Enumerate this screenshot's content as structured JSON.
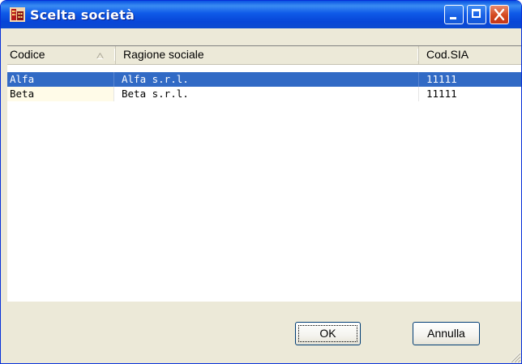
{
  "window": {
    "title": "Scelta società",
    "icon": "company-app-icon",
    "controls": [
      "minimize-icon",
      "maximize-icon",
      "close-icon"
    ]
  },
  "table": {
    "columns": [
      "Codice",
      "Ragione sociale",
      "Cod.SIA"
    ],
    "sort_indicator": "sort-ascending-icon",
    "rows": [
      {
        "code": "Alfa",
        "name": "Alfa s.r.l.",
        "sia": "11111",
        "selected": true
      },
      {
        "code": "Beta",
        "name": "Beta s.r.l.",
        "sia": "11111",
        "selected": false
      }
    ]
  },
  "buttons": {
    "ok": "OK",
    "cancel": "Annulla"
  },
  "colors": {
    "titlebar": "#0a53e2",
    "selection": "#316ac5",
    "face": "#ece9d8"
  }
}
